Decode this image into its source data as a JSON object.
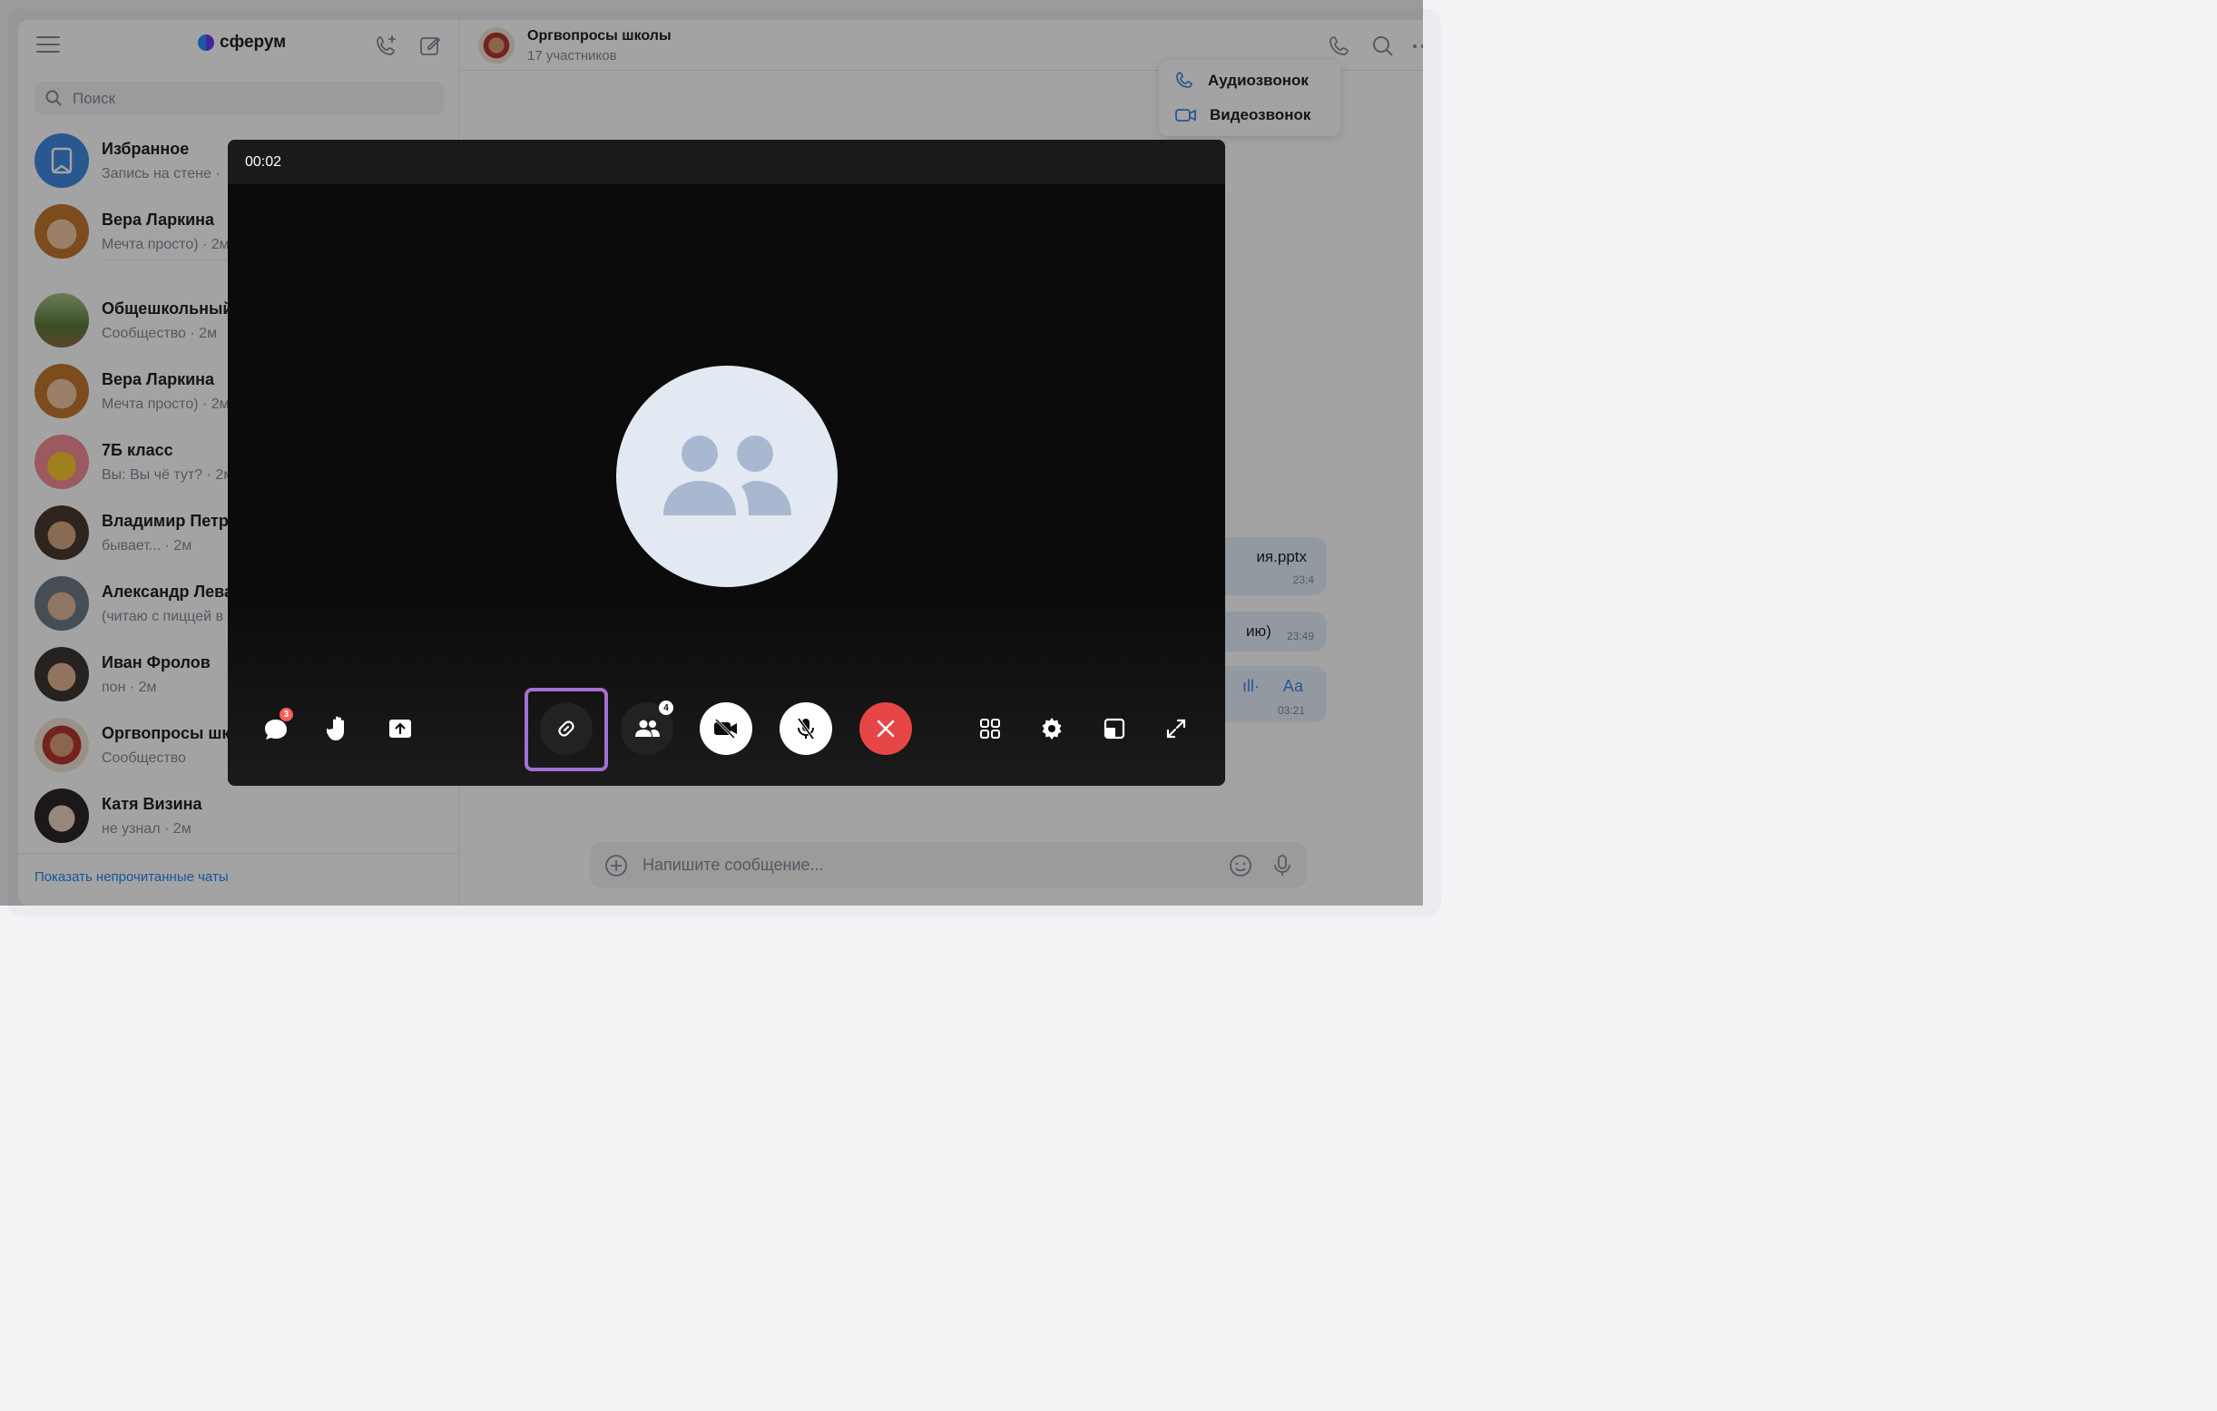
{
  "app": {
    "brand": "сферум"
  },
  "search": {
    "placeholder": "Поиск"
  },
  "chats": [
    {
      "name": "Избранное",
      "preview": "Запись на стене ·"
    },
    {
      "name": "Вера Ларкина",
      "preview": "Мечта просто) · 2м"
    },
    {
      "name": "Общешкольный",
      "preview": "Сообщество · 2м"
    },
    {
      "name": "Вера Ларкина",
      "preview": "Мечта просто) · 2м"
    },
    {
      "name": "7Б класс",
      "preview": "Вы: Вы чё тут? · 2м"
    },
    {
      "name": "Владимир Петр",
      "preview": "бывает... · 2м"
    },
    {
      "name": "Александр Лева",
      "preview": "(читаю с пиццей в"
    },
    {
      "name": "Иван Фролов",
      "preview": "пон · 2м"
    },
    {
      "name": "Оргвопросы шк",
      "preview": "Сообщество"
    },
    {
      "name": "Катя Визина",
      "preview": "не узнал · 2м"
    }
  ],
  "sidebar": {
    "show_unread": "Показать непрочитанные чаты"
  },
  "conversation": {
    "title": "Оргвопросы школы",
    "subtitle": "17 участников",
    "call_menu": [
      "Аудиозвонок",
      "Видеозвонок"
    ],
    "bubbles": [
      {
        "text": "ия.pptx",
        "time": "23:4"
      },
      {
        "text": "ию)",
        "time": "23:49"
      },
      {
        "text": "Аа",
        "time": "03:21"
      }
    ],
    "composer_placeholder": "Напишите сообщение..."
  },
  "call": {
    "timer": "00:02",
    "chat_badge": "3",
    "participants_badge": "4",
    "controls": [
      "chat",
      "raise-hand",
      "share-screen",
      "copy-link",
      "participants",
      "camera-off",
      "mic-off",
      "end-call",
      "grid-layout",
      "settings",
      "minimize",
      "fullscreen"
    ]
  },
  "colors": {
    "accent": "#2688eb",
    "end_call": "#e64646",
    "highlight": "#a56ed0",
    "call_bg": "#0b0b0b",
    "avatar_bg": "#e3e9f2"
  }
}
